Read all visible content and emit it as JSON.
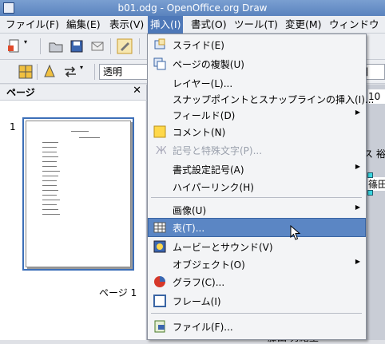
{
  "window": {
    "title": "b01.odg - OpenOffice.org Draw"
  },
  "menubar": {
    "items": [
      "ファイル(F)",
      "編集(E)",
      "表示(V)",
      "挿入(I)",
      "書式(O)",
      "ツール(T)",
      "変更(M)",
      "ウィンドウ(W)"
    ],
    "active_index": 3
  },
  "toolbar2": {
    "line_style": "透明",
    "right_combo": "目"
  },
  "side_panel": {
    "title": "ページ",
    "page_number": "1",
    "page_label": "ページ 1"
  },
  "canvas": {
    "ruler_value": "10",
    "name_fragment": "ス 裕",
    "cell_fragment": "篠田 ラ",
    "bottom_text": "藤田 秀緒里"
  },
  "insert_menu": {
    "items": [
      {
        "label": "スライド(E)",
        "icon": "slide-icon",
        "enabled": true
      },
      {
        "label": "ページの複製(U)",
        "icon": "duplicate-page-icon",
        "enabled": true
      },
      {
        "label": "レイヤー(L)...",
        "icon": "",
        "enabled": true
      },
      {
        "label": "スナップポイントとスナップラインの挿入(I)...",
        "icon": "",
        "enabled": true
      },
      {
        "label": "フィールド(D)",
        "icon": "",
        "enabled": true,
        "submenu": true
      },
      {
        "label": "コメント(N)",
        "icon": "comment-icon",
        "enabled": true
      },
      {
        "label": "記号と特殊文字(P)...",
        "icon": "special-character-icon",
        "enabled": false
      },
      {
        "label": "書式設定記号(A)",
        "icon": "",
        "enabled": true,
        "submenu": true
      },
      {
        "label": "ハイパーリンク(H)",
        "icon": "",
        "enabled": true
      },
      {
        "label": "画像(U)",
        "icon": "",
        "enabled": true,
        "submenu": true
      },
      {
        "label": "表(T)...",
        "icon": "table-icon",
        "enabled": true,
        "highlighted": true
      },
      {
        "label": "ムービーとサウンド(V)",
        "icon": "movie-sound-icon",
        "enabled": true
      },
      {
        "label": "オブジェクト(O)",
        "icon": "",
        "enabled": true,
        "submenu": true
      },
      {
        "label": "グラフ(C)...",
        "icon": "chart-icon",
        "enabled": true
      },
      {
        "label": "フレーム(I)",
        "icon": "frame-icon",
        "enabled": true
      },
      {
        "label": "ファイル(F)...",
        "icon": "file-icon",
        "enabled": true
      }
    ]
  },
  "colors": {
    "menu_highlight": "#5b86c4",
    "title_bar": "#6a90c8"
  }
}
